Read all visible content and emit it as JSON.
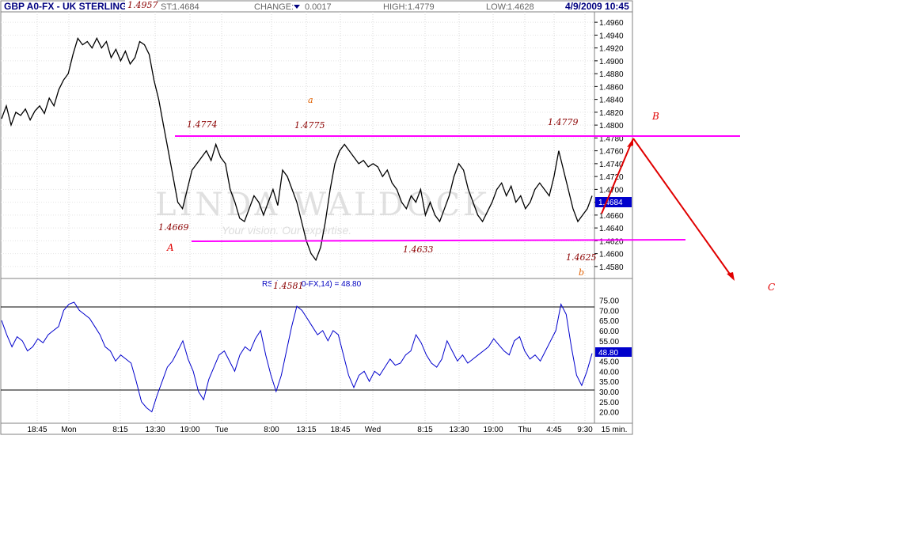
{
  "header": {
    "title": "GBP A0-FX - UK STERLING",
    "last_label": "ST:",
    "last_value": "1.4684",
    "change_label": "CHANGE:",
    "change_value": "0.0017",
    "high_label": "HIGH:",
    "high_value": "1.4779",
    "low_label": "LOW:",
    "low_value": "1.4628",
    "datetime": "4/9/2009 10:45"
  },
  "watermark": {
    "main": "LINDA WALDOCK",
    "sub": "Your vision. Our expertise."
  },
  "colors": {
    "price_line": "#000000",
    "rsi_line": "#0000cc",
    "guide_lines": "#ff00ff",
    "projection": "#e00000",
    "last_box": "#0000cc"
  },
  "chart_data": [
    {
      "type": "line",
      "title": "GBP A0-FX - UK STERLING",
      "ylim": [
        1.457,
        1.497
      ],
      "grid": true,
      "x_tick_labels": [
        "18:45",
        "Mon",
        "8:15",
        "13:30",
        "19:00",
        "Tue",
        "8:00",
        "13:15",
        "18:45",
        "Wed",
        "8:15",
        "13:30",
        "19:00",
        "Thu",
        "4:45",
        "9:30",
        "15 min."
      ],
      "y_tick_labels": [
        "1.4960",
        "1.4940",
        "1.4920",
        "1.4900",
        "1.4880",
        "1.4860",
        "1.4840",
        "1.4820",
        "1.4800",
        "1.4780",
        "1.4760",
        "1.4740",
        "1.4720",
        "1.4700",
        "1.4680",
        "1.4660",
        "1.4640",
        "1.4620",
        "1.4600",
        "1.4580"
      ],
      "last_value_label": "1.4684",
      "series": [
        {
          "values": [
            1.481,
            1.483,
            1.48,
            1.482,
            1.4815,
            1.4825,
            1.4808,
            1.4822,
            1.483,
            1.4818,
            1.4842,
            1.483,
            1.4855,
            1.487,
            1.488,
            1.491,
            1.4935,
            1.4925,
            1.493,
            1.492,
            1.4935,
            1.492,
            1.493,
            1.4905,
            1.4918,
            1.49,
            1.4915,
            1.4895,
            1.4905,
            1.493,
            1.4925,
            1.491,
            1.487,
            1.484,
            1.48,
            1.476,
            1.472,
            1.468,
            1.467,
            1.47,
            1.473,
            1.474,
            1.475,
            1.476,
            1.4745,
            1.477,
            1.475,
            1.474,
            1.47,
            1.468,
            1.4655,
            1.465,
            1.467,
            1.469,
            1.468,
            1.466,
            1.468,
            1.47,
            1.4675,
            1.473,
            1.472,
            1.47,
            1.468,
            1.465,
            1.462,
            1.46,
            1.459,
            1.461,
            1.465,
            1.47,
            1.474,
            1.476,
            1.477,
            1.476,
            1.475,
            1.474,
            1.4745,
            1.4735,
            1.474,
            1.4735,
            1.472,
            1.473,
            1.471,
            1.47,
            1.468,
            1.467,
            1.469,
            1.468,
            1.47,
            1.466,
            1.468,
            1.466,
            1.465,
            1.467,
            1.469,
            1.472,
            1.474,
            1.473,
            1.47,
            1.468,
            1.466,
            1.465,
            1.4665,
            1.468,
            1.47,
            1.471,
            1.469,
            1.4705,
            1.468,
            1.469,
            1.467,
            1.468,
            1.47,
            1.471,
            1.47,
            1.469,
            1.472,
            1.476,
            1.473,
            1.47,
            1.467,
            1.465,
            1.466,
            1.467,
            1.469
          ]
        }
      ],
      "annotations": [
        "1.4957",
        "1.4774",
        "1.4775",
        "1.4779",
        "1.4669",
        "1.4633",
        "1.4625",
        "1.4581",
        "a",
        "b",
        "A",
        "B",
        "C"
      ]
    },
    {
      "type": "line",
      "title": "RSI(GBP A0-FX,14) = 48.80",
      "ylim": [
        17.5,
        77.5
      ],
      "grid": true,
      "y_tick_labels": [
        "75.00",
        "70.00",
        "65.00",
        "60.00",
        "55.00",
        "50.00",
        "45.00",
        "40.00",
        "35.00",
        "30.00",
        "25.00",
        "20.00"
      ],
      "last_value_label": "48.80",
      "series": [
        {
          "values": [
            65,
            58,
            52,
            57,
            55,
            50,
            52,
            56,
            54,
            58,
            60,
            62,
            70,
            73,
            74,
            70,
            68,
            66,
            62,
            58,
            52,
            50,
            45,
            48,
            46,
            44,
            35,
            25,
            22,
            20,
            28,
            35,
            42,
            45,
            50,
            55,
            46,
            40,
            30,
            26,
            36,
            42,
            48,
            50,
            45,
            40,
            48,
            52,
            50,
            56,
            60,
            48,
            38,
            30,
            38,
            50,
            62,
            72,
            70,
            66,
            62,
            58,
            60,
            55,
            60,
            58,
            48,
            38,
            32,
            38,
            40,
            35,
            40,
            38,
            42,
            46,
            43,
            44,
            48,
            50,
            58,
            54,
            48,
            44,
            42,
            46,
            55,
            50,
            45,
            48,
            44,
            46,
            48,
            50,
            52,
            56,
            53,
            50,
            48,
            55,
            57,
            50,
            46,
            48,
            45,
            50,
            55,
            60,
            73,
            68,
            52,
            38,
            33,
            40,
            48.8
          ]
        }
      ],
      "reference_lines": [
        30,
        70
      ]
    }
  ],
  "annotations": {
    "peak_top": "1.4957",
    "a_left": "1.4774",
    "a_mid": "1.4775",
    "a_right": "1.4779",
    "low_left": "1.4669",
    "low_mid": "1.4633",
    "low_right": "1.4625",
    "low_deep": "1.4581",
    "wave_a": "a",
    "wave_b": "b",
    "wave_A": "A",
    "wave_B": "B",
    "wave_C": "C"
  },
  "rsi_label": "RSI(GBP A0-FX,14) = 48.80"
}
